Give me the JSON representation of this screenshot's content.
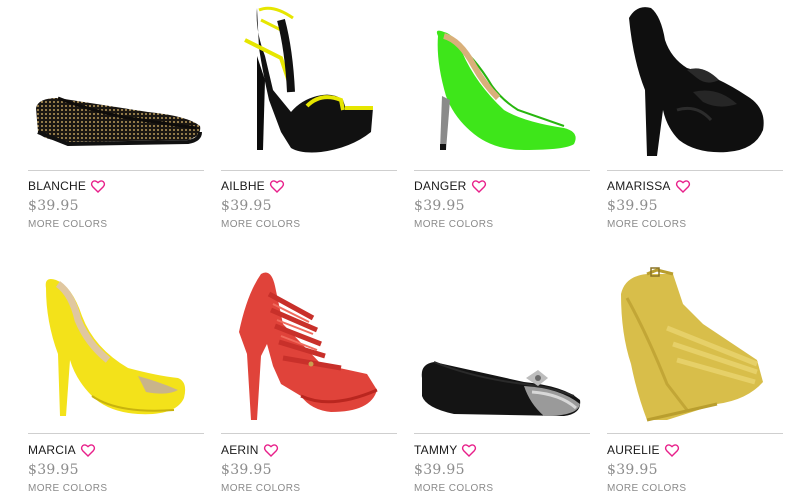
{
  "colors": {
    "heart": "#e8208a",
    "price": "#8c8c8c",
    "divider": "#cfcfcf"
  },
  "products": [
    {
      "name": "BLANCHE",
      "price": "$39.95",
      "more_colors": "MORE COLORS",
      "icon": "heart-icon"
    },
    {
      "name": "AILBHE",
      "price": "$39.95",
      "more_colors": "MORE COLORS",
      "icon": "heart-icon"
    },
    {
      "name": "DANGER",
      "price": "$39.95",
      "more_colors": "MORE COLORS",
      "icon": "heart-icon"
    },
    {
      "name": "AMARISSA",
      "price": "$39.95",
      "more_colors": "MORE COLORS",
      "icon": "heart-icon"
    },
    {
      "name": "MARCIA",
      "price": "$39.95",
      "more_colors": "MORE COLORS",
      "icon": "heart-icon"
    },
    {
      "name": "AERIN",
      "price": "$39.95",
      "more_colors": "MORE COLORS",
      "icon": "heart-icon"
    },
    {
      "name": "TAMMY",
      "price": "$39.95",
      "more_colors": "MORE COLORS",
      "icon": "heart-icon"
    },
    {
      "name": "AURELIE",
      "price": "$39.95",
      "more_colors": "MORE COLORS",
      "icon": "heart-icon"
    }
  ]
}
